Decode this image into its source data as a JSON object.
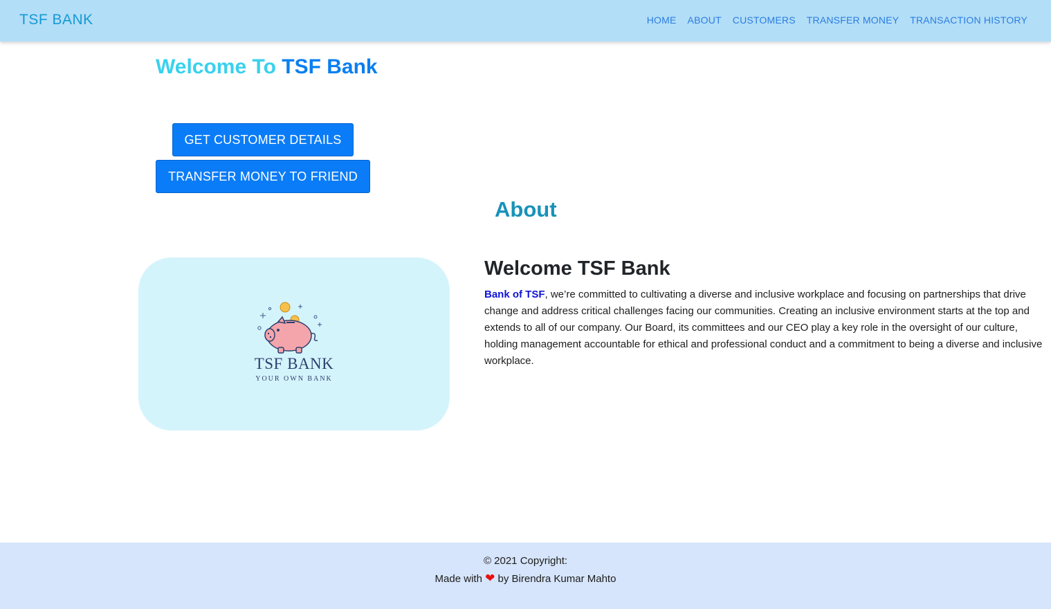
{
  "navbar": {
    "brand": "TSF BANK",
    "links": [
      "HOME",
      "ABOUT",
      "CUSTOMERS",
      "TRANSFER MONEY",
      "TRANSACTION HISTORY"
    ]
  },
  "hero": {
    "title_prefix": "Welcome To",
    "title_brand": "TSF Bank",
    "buttons": {
      "details": "GET CUSTOMER DETAILS",
      "transfer": "TRANSFER MONEY TO FRIEND"
    }
  },
  "about": {
    "title": "About",
    "logo": {
      "name": "TSF BANK",
      "tagline": "YOUR OWN BANK"
    },
    "heading": "Welcome TSF Bank",
    "bold_lead": "Bank of TSF",
    "paragraph": ", we’re committed to cultivating a diverse and inclusive workplace and focusing on partnerships that drive change and address critical challenges facing our communities. Creating an inclusive environment starts at the top and extends to all of our company. Our Board, its committees and our CEO play a key role in the oversight of our culture, holding management accountable for ethical and professional conduct and a commitment to being a diverse and inclusive workplace."
  },
  "footer": {
    "copyright": "© 2021 Copyright:",
    "made_with": "Made with",
    "by": "by Birendra Kumar Mahto",
    "heart_icon": "heart-icon"
  },
  "colors": {
    "navbar_bg": "#b3def7",
    "brand": "#1599d6",
    "nav_link": "#2a7de1",
    "primary_button": "#0a7cf7",
    "about_title": "#1892b8",
    "logo_card_bg": "#d4f4fc",
    "footer_bg": "#d6e5fb",
    "heart": "#e81010"
  }
}
